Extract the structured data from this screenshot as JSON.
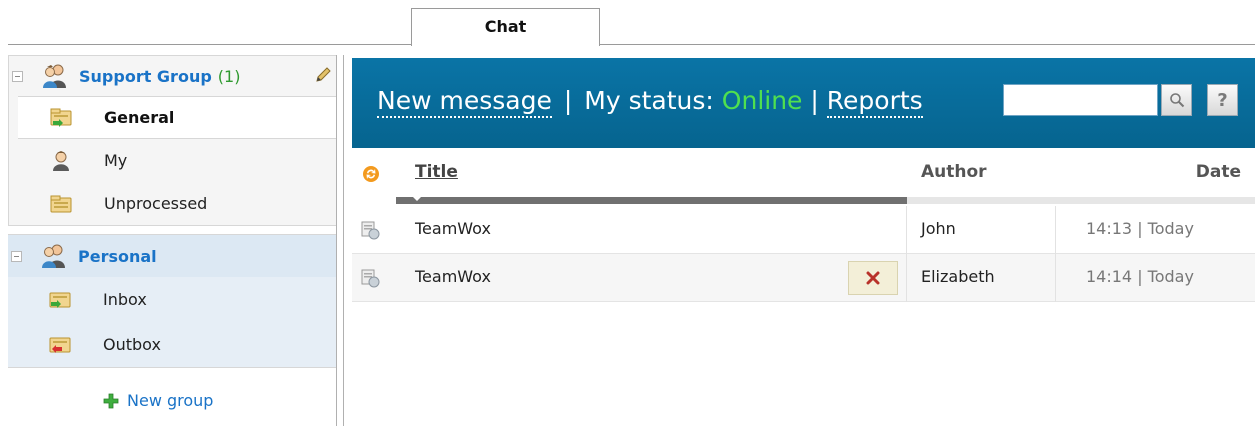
{
  "tabs": [
    {
      "label": "Chat",
      "active": true
    }
  ],
  "sidebar": {
    "groups": [
      {
        "title": "Support Group",
        "count": "(1)",
        "icon": "users-icon",
        "items": [
          {
            "label": "General",
            "icon": "folder-in-icon",
            "active": true
          },
          {
            "label": "My",
            "icon": "user-icon",
            "active": false
          },
          {
            "label": "Unprocessed",
            "icon": "folder-icon",
            "active": false
          }
        ]
      },
      {
        "title": "Personal",
        "icon": "users-icon",
        "items": [
          {
            "label": "Inbox",
            "icon": "inbox-icon"
          },
          {
            "label": "Outbox",
            "icon": "outbox-icon"
          }
        ]
      }
    ],
    "new_group_label": "New group"
  },
  "toolbar": {
    "new_message": "New message",
    "separator": "|",
    "my_status_label": "My status:",
    "status_value": "Online",
    "reports": "Reports",
    "search_value": "",
    "help_label": "?"
  },
  "list": {
    "columns": {
      "title": "Title",
      "author": "Author",
      "date": "Date"
    },
    "rows": [
      {
        "title": "TeamWox",
        "author": "John",
        "date": "14:13 | Today"
      },
      {
        "title": "TeamWox",
        "author": "Elizabeth",
        "date": "14:14 | Today"
      }
    ]
  },
  "colors": {
    "toolbar_bg": "#0a74a6",
    "online": "#4fe04f",
    "group_title": "#1a73c7",
    "count": "#2f9a2f"
  }
}
